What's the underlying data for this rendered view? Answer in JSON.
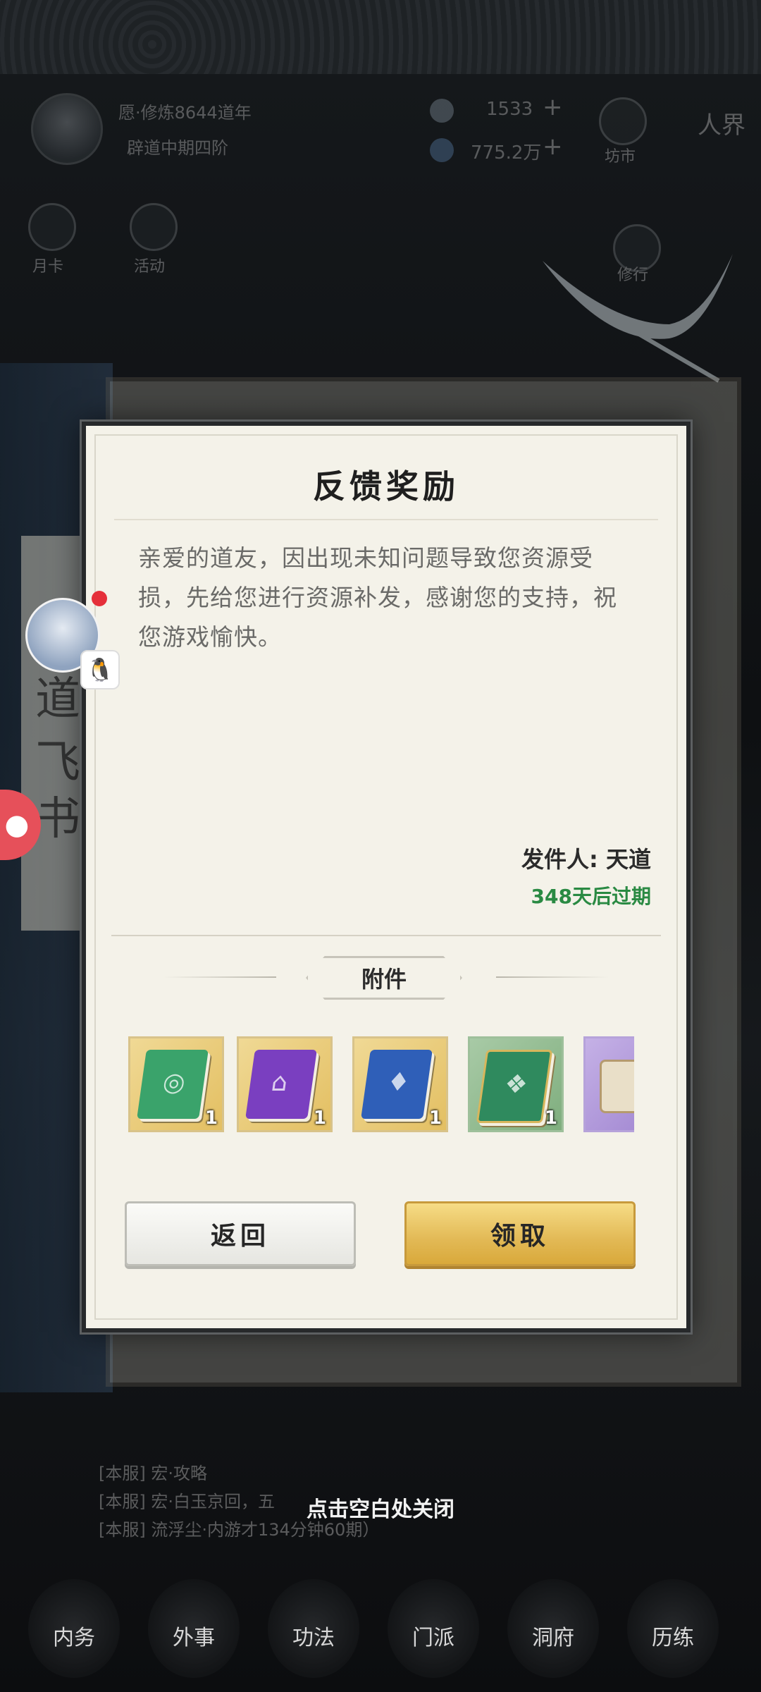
{
  "hud": {
    "player_name": "愿·修炼8644道年",
    "player_rank": "辟道中期四阶",
    "currency1": "1533",
    "currency2": "775.2万",
    "market_label": "坊市",
    "realm_label": "人界",
    "monthly_card_label": "月卡",
    "events_label": "活动",
    "practice_label": "修行",
    "list_lines": [
      "[本服] 宏·攻略",
      "[本服] 宏·白玉京回，五",
      "[本服] 流浮尘·内游才134分钟60期）"
    ],
    "left_calli": [
      "道",
      "飞",
      "书"
    ],
    "bottom_nav": [
      "内务",
      "外事",
      "功法",
      "门派",
      "洞府",
      "历练"
    ]
  },
  "modal": {
    "title": "反馈奖励",
    "body": "亲爱的道友，因出现未知问题导致您资源受损，先给您进行资源补发，感谢您的支持，祝您游戏愉快。",
    "sender": "发件人: 天道",
    "expire": "348天后过期",
    "attachments_label": "附件",
    "items": [
      {
        "icon": "green-book-icon",
        "qty": "1",
        "color": "#3aa36b"
      },
      {
        "icon": "purple-book-icon",
        "qty": "1",
        "color": "#7a3fc0"
      },
      {
        "icon": "blue-book-icon",
        "qty": "1",
        "color": "#2f5fb8"
      },
      {
        "icon": "jade-manual-icon",
        "qty": "1",
        "color": "#2f8a5e"
      },
      {
        "icon": "scroll-icon",
        "qty": "",
        "color": "#9d82cf"
      }
    ],
    "back_button": "返回",
    "claim_button": "领取"
  },
  "close_hint": "点击空白处关闭",
  "colors": {
    "expire_green": "#2a8a43",
    "claim_gold": "#e2b955"
  }
}
